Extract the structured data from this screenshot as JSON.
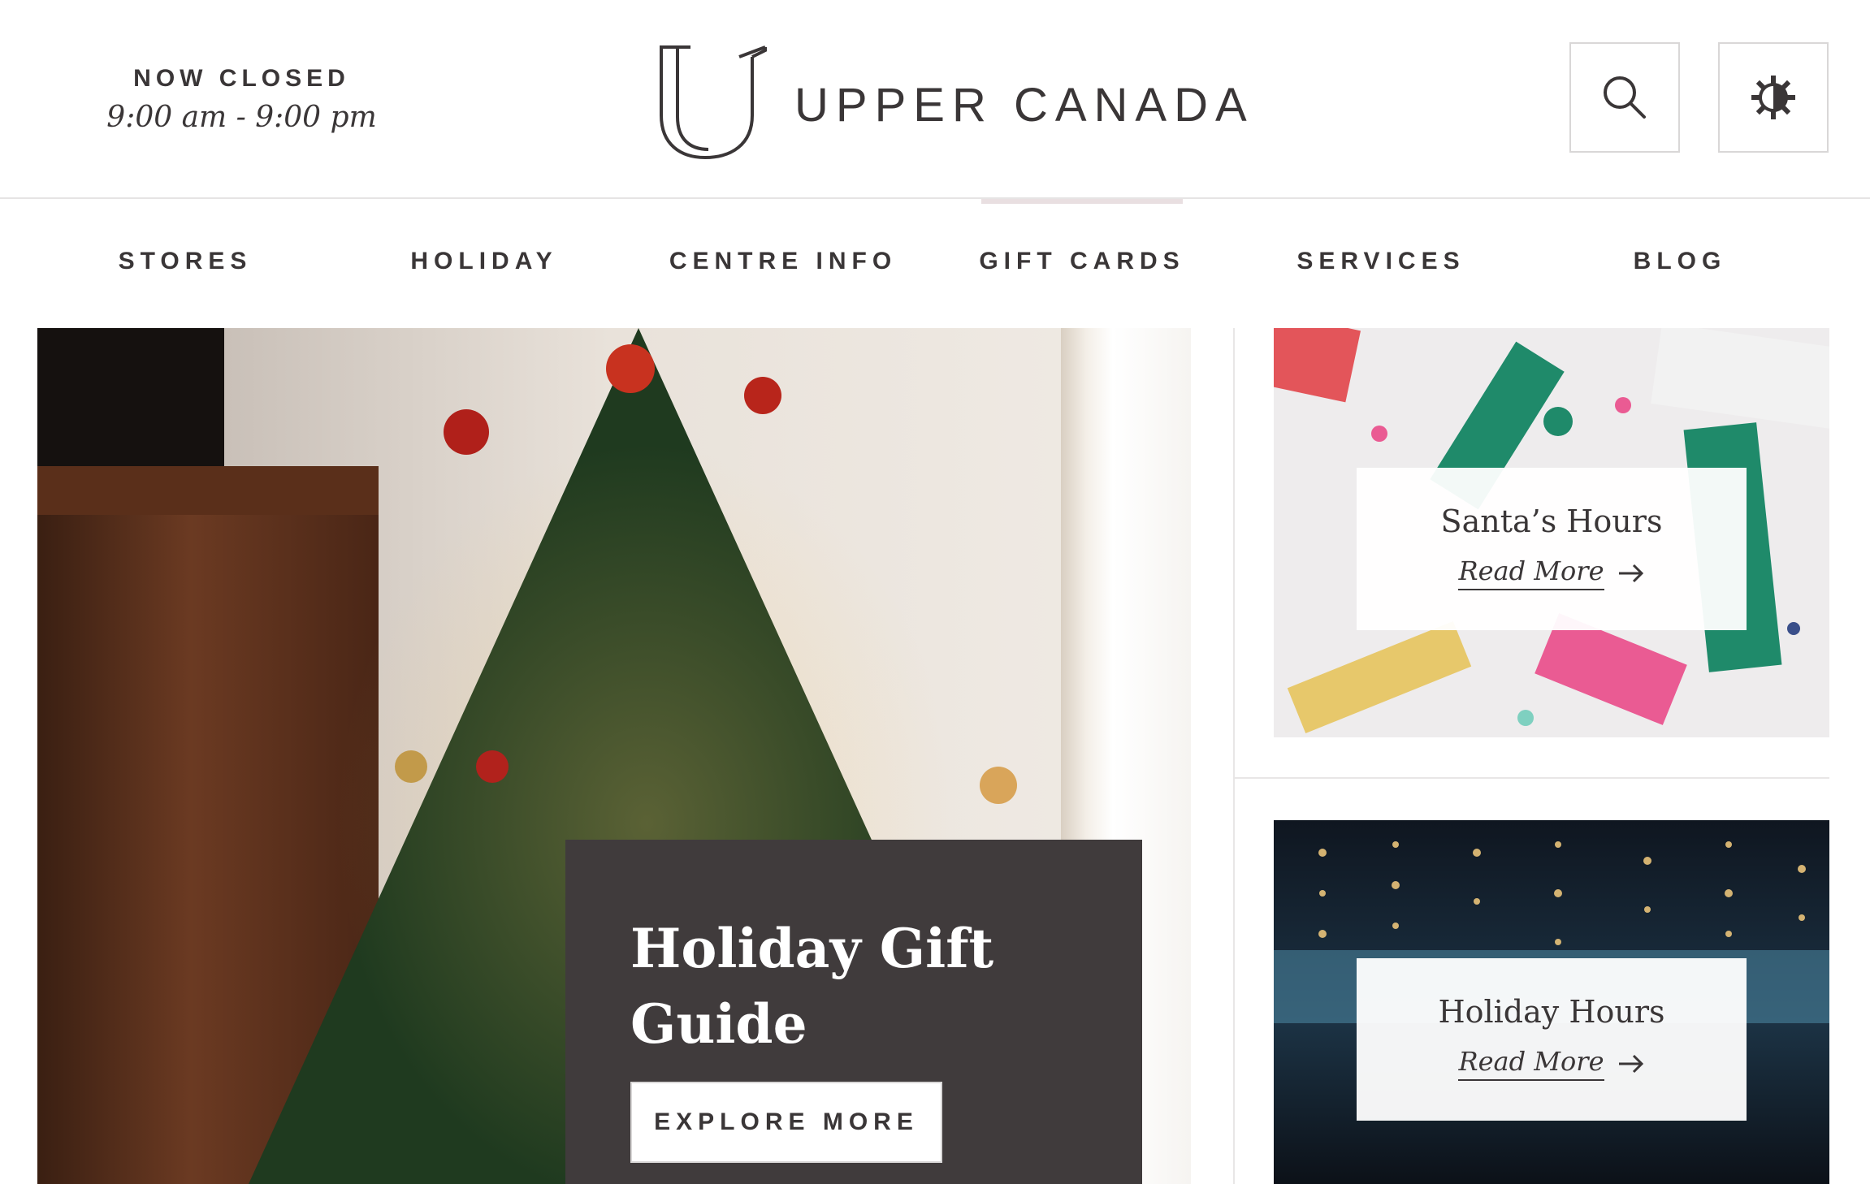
{
  "header": {
    "status": "NOW CLOSED",
    "hours": "9:00 am - 9:00 pm",
    "brand": "UPPER CANADA"
  },
  "icons": {
    "search": "search-icon",
    "theme": "contrast-toggle-icon",
    "logo": "logo-u-mark",
    "arrow": "arrow-right-icon"
  },
  "nav": {
    "items": [
      {
        "label": "STORES"
      },
      {
        "label": "HOLIDAY"
      },
      {
        "label": "CENTRE INFO"
      },
      {
        "label": "GIFT CARDS",
        "active": true
      },
      {
        "label": "SERVICES"
      },
      {
        "label": "BLOG"
      }
    ]
  },
  "hero": {
    "title": "Holiday Gift Guide",
    "cta_label": "EXPLORE MORE"
  },
  "sidebar": {
    "cards": [
      {
        "title": "Santa’s Hours",
        "link_label": "Read More"
      },
      {
        "title": "Holiday Hours",
        "link_label": "Read More"
      }
    ]
  },
  "colors": {
    "text": "#3a3637",
    "hero_card_bg": "#403b3c",
    "nav_active_bar": "#e9dfe1",
    "divider": "#e6e4e4"
  }
}
